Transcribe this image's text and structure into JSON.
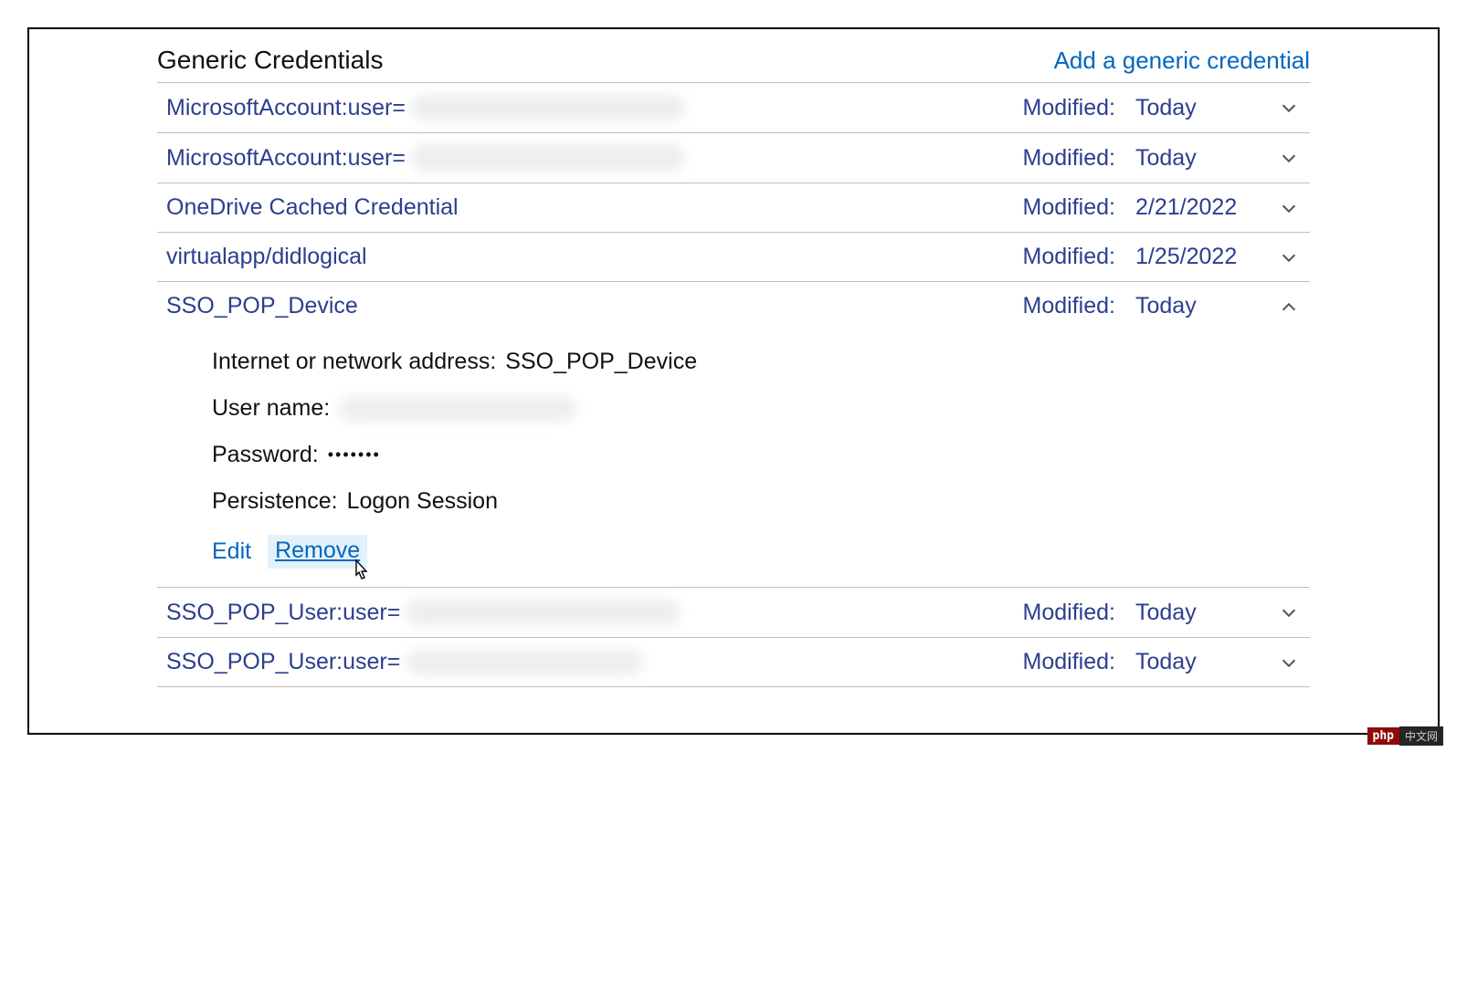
{
  "section": {
    "title": "Generic Credentials",
    "add_link": "Add a generic credential"
  },
  "labels": {
    "modified": "Modified:",
    "address": "Internet or network address:",
    "username": "User name:",
    "password": "Password:",
    "persistence": "Persistence:",
    "edit": "Edit",
    "remove": "Remove"
  },
  "credentials": [
    {
      "name_prefix": "MicrosoftAccount:user=",
      "blurred": true,
      "modified": "Today",
      "expanded": false
    },
    {
      "name_prefix": "MicrosoftAccount:user=",
      "blurred": true,
      "modified": "Today",
      "expanded": false
    },
    {
      "name_prefix": "OneDrive Cached Credential",
      "blurred": false,
      "modified": "2/21/2022",
      "expanded": false
    },
    {
      "name_prefix": "virtualapp/didlogical",
      "blurred": false,
      "modified": "1/25/2022",
      "expanded": false
    },
    {
      "name_prefix": "SSO_POP_Device",
      "blurred": false,
      "modified": "Today",
      "expanded": true
    },
    {
      "name_prefix": "SSO_POP_User:user=",
      "blurred": true,
      "modified": "Today",
      "expanded": false
    },
    {
      "name_prefix": "SSO_POP_User:user=",
      "blurred": true,
      "modified": "Today",
      "expanded": false
    }
  ],
  "detail": {
    "address_value": "SSO_POP_Device",
    "username_blurred": true,
    "password_value": "•••••••",
    "persistence_value": "Logon Session"
  },
  "watermark": {
    "left": "php",
    "right": "中文网"
  }
}
